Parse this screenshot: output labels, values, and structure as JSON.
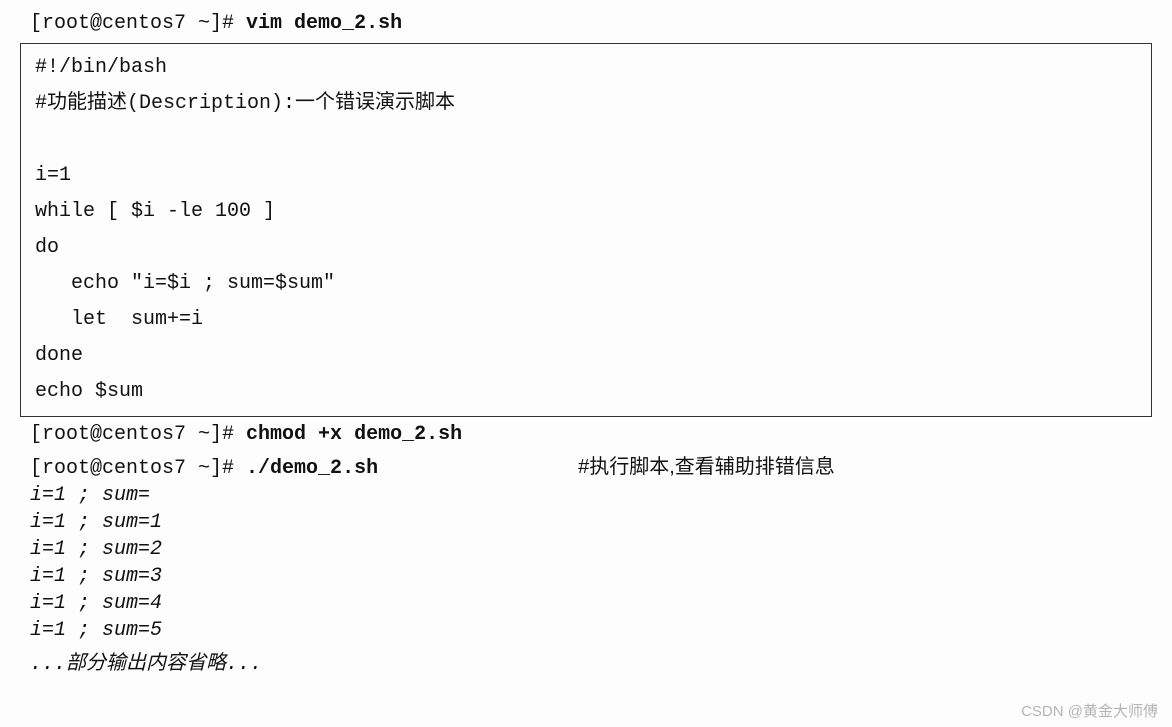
{
  "cmd1": {
    "prompt": "[root@centos7 ~]# ",
    "command": "vim demo_2.sh"
  },
  "script": {
    "l1": "#!/bin/bash",
    "l2": "#功能描述(Description):一个错误演示脚本",
    "l3": "",
    "l4": "i=1",
    "l5": "while [ $i -le 100 ]",
    "l6": "do",
    "l7": "   echo \"i=$i ; sum=$sum\"",
    "l8": "   let  sum+=i",
    "l9": "done",
    "l10": "echo $sum"
  },
  "cmd2": {
    "prompt": "[root@centos7 ~]# ",
    "command": "chmod +x demo_2.sh"
  },
  "cmd3": {
    "prompt": "[root@centos7 ~]# ",
    "command": "./demo_2.sh",
    "note": "#执行脚本,查看辅助排错信息"
  },
  "out": {
    "o1": "i=1 ; sum=",
    "o2": "i=1 ; sum=1",
    "o3": "i=1 ; sum=2",
    "o4": "i=1 ; sum=3",
    "o5": "i=1 ; sum=4",
    "o6": "i=1 ; sum=5",
    "o7": "...部分输出内容省略..."
  },
  "watermark": "CSDN @黄金大师傅"
}
